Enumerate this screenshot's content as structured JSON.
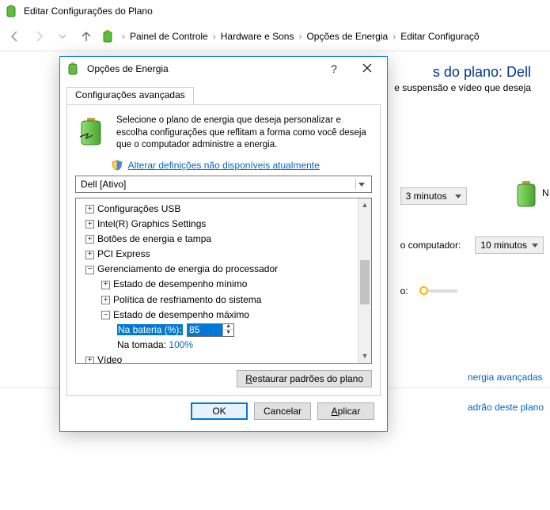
{
  "window": {
    "title": "Editar Configurações do Plano"
  },
  "breadcrumbs": [
    "Painel de Controle",
    "Hardware e Sons",
    "Opções de Energia",
    "Editar Configuraçõ"
  ],
  "bg": {
    "plan_title_suffix": "s do plano: Dell",
    "plan_sub_suffix": "e suspensão e vídeo que deseja",
    "battery_header_char": "N",
    "sleep_value": "3 minutos",
    "row2_label_suffix": "o computador:",
    "display_value": "10 minutos",
    "row3_label_suffix": "o:",
    "link_adv": "nergia avançadas",
    "link_restore": "adrão deste plano"
  },
  "dialog": {
    "title": "Opções de Energia",
    "help": "?",
    "tab": "Configurações avançadas",
    "desc": "Selecione o plano de energia que deseja personalizar e escolha configurações que reflitam a forma como você deseja que o computador administre a energia.",
    "unavail_link": "Alterar definições não disponíveis atualmente",
    "plan_selected": "Dell [Ativo]",
    "tree": {
      "usb": "Configurações USB",
      "intel": "Intel(R) Graphics Settings",
      "buttons": "Botões de energia e tampa",
      "pci": "PCI Express",
      "cpu": "Gerenciamento de energia do processador",
      "min_state": "Estado de desempenho mínimo",
      "cooling": "Política de resfriamento do sistema",
      "max_state": "Estado de desempenho máximo",
      "on_batt_label": "Na bateria (%):",
      "on_batt_value": "85",
      "on_ac_label": "Na tomada:",
      "on_ac_value": "100%",
      "video": "Vídeo"
    },
    "restore": "Restaurar padrões do plano",
    "ok": "OK",
    "cancel": "Cancelar",
    "apply": "Aplicar"
  }
}
